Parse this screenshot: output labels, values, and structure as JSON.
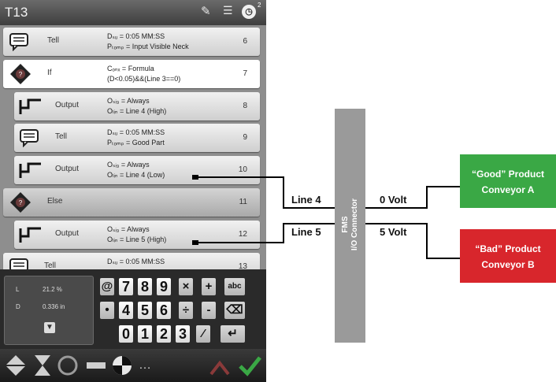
{
  "device": {
    "title": "T13",
    "superscript": "2",
    "rows": [
      {
        "id": "tell-1",
        "icon": "speech-bubble-icon",
        "label": "Tell",
        "line1": "Dₛᵤ = 0:05 MM:SS",
        "line2": "Pₜₒₘₚ = Input Visible Neck",
        "num": "6"
      },
      {
        "id": "if",
        "icon": "diamond-question-icon",
        "label": "If",
        "line1": "Cₒₙₓ = Formula",
        "line2": "(D<0.05)&&(Line 3==0)",
        "num": "7"
      },
      {
        "id": "output-1",
        "icon": "step-output-icon",
        "label": "Output",
        "line1": "Oₛᵢ₉ = Always",
        "line2": "Oₗᵢₙ = Line 4 (High)",
        "num": "8"
      },
      {
        "id": "tell-2",
        "icon": "speech-bubble-icon",
        "label": "Tell",
        "line1": "Dₛᵤ = 0:05 MM:SS",
        "line2": "Pₜₒₘₚ = Good Part",
        "num": "9"
      },
      {
        "id": "output-2",
        "icon": "step-output-icon",
        "label": "Output",
        "line1": "Oₛᵢ₉ = Always",
        "line2": "Oₗᵢₙ = Line 4 (Low)",
        "num": "10"
      },
      {
        "id": "else",
        "icon": "diamond-question-icon",
        "label": "Else",
        "line1": "",
        "line2": "",
        "num": "11"
      },
      {
        "id": "output-3",
        "icon": "step-output-icon",
        "label": "Output",
        "line1": "Oₛᵢ₉ = Always",
        "line2": "Oₗᵢₙ = Line 5 (High)",
        "num": "12"
      },
      {
        "id": "tell-3",
        "icon": "speech-bubble-icon",
        "label": "Tell",
        "line1": "Dₛᵤ = 0:05 MM:SS",
        "line2": "",
        "num": "13"
      }
    ],
    "readout": {
      "l_label": "L",
      "l_value": "21.2 %",
      "d_label": "D",
      "d_value": "0.336 in"
    },
    "keys": {
      "at": "@",
      "k7": "7",
      "k8": "8",
      "k9": "9",
      "mul": "×",
      "plus": "+",
      "abc": "abc",
      "dot": "•",
      "k4": "4",
      "k5": "5",
      "k6": "6",
      "div": "÷",
      "minus": "-",
      "bksp": "⌫",
      "k0": "0",
      "k1": "1",
      "k2": "2",
      "k3": "3",
      "pct": "⁄",
      "enter": "↵"
    }
  },
  "diagram": {
    "connector_title": "FMS",
    "connector_subtitle": "I/O Connector",
    "line4_label": "Line 4",
    "line5_label": "Line 5",
    "volt0_label": "0 Volt",
    "volt5_label": "5 Volt",
    "good_box": {
      "line1": "“Good” Product",
      "line2": "Conveyor A",
      "color": "#3aa845"
    },
    "bad_box": {
      "line1": "“Bad” Product",
      "line2": "Conveyor B",
      "color": "#d8262c"
    }
  }
}
